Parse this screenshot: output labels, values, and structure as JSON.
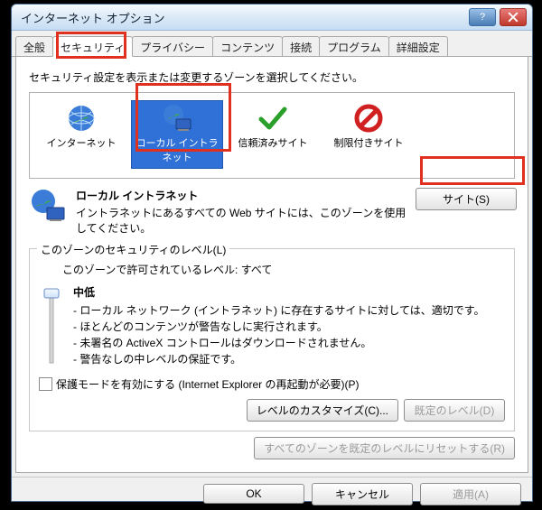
{
  "title": "インターネット オプション",
  "tabs": [
    {
      "label": "全般"
    },
    {
      "label": "セキュリティ",
      "active": true
    },
    {
      "label": "プライバシー"
    },
    {
      "label": "コンテンツ"
    },
    {
      "label": "接続"
    },
    {
      "label": "プログラム"
    },
    {
      "label": "詳細設定"
    }
  ],
  "zone_instruction": "セキュリティ設定を表示または変更するゾーンを選択してください。",
  "zones": [
    {
      "label": "インターネット"
    },
    {
      "label": "ローカル イントラネット",
      "selected": true
    },
    {
      "label": "信頼済みサイト"
    },
    {
      "label": "制限付きサイト"
    }
  ],
  "zone_desc": {
    "header": "ローカル イントラネット",
    "body": "イントラネットにあるすべての Web サイトには、このゾーンを使用してください。"
  },
  "sites_button": "サイト(S)",
  "level": {
    "legend": "このゾーンのセキュリティのレベル(L)",
    "allowed": "このゾーンで許可されているレベル: すべて",
    "name": "中低",
    "points": [
      "ローカル ネットワーク (イントラネット) に存在するサイトに対しては、適切です。",
      "ほとんどのコンテンツが警告なしに実行されます。",
      "未署名の ActiveX コントロールはダウンロードされません。",
      "警告なしの中レベルの保証です。"
    ]
  },
  "protected_mode": "保護モードを有効にする (Internet Explorer の再起動が必要)(P)",
  "buttons": {
    "custom": "レベルのカスタマイズ(C)...",
    "default": "既定のレベル(D)",
    "reset_all": "すべてのゾーンを既定のレベルにリセットする(R)",
    "ok": "OK",
    "cancel": "キャンセル",
    "apply": "適用(A)"
  }
}
